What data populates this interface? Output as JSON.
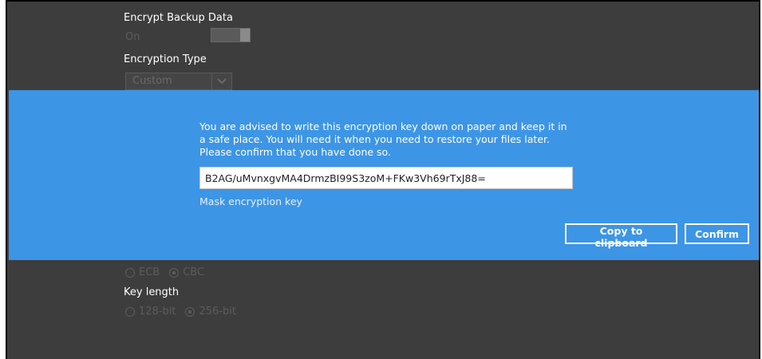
{
  "background": {
    "encrypt_label": "Encrypt Backup Data",
    "encrypt_value": "On",
    "type_label": "Encryption Type",
    "type_value": "Custom",
    "mode_options": [
      "ECB",
      "CBC"
    ],
    "mode_selected": "CBC",
    "key_length_label": "Key length",
    "key_length_options": [
      "128-bit",
      "256-bit"
    ],
    "key_length_selected": "256-bit"
  },
  "dialog": {
    "message_line1": "You are advised to write this encryption key down on paper and keep it in",
    "message_line2": "a safe place. You will need it when you need to restore your files later.",
    "message_line3": "Please confirm that you have done so.",
    "key_value": "B2AG/uMvnxgvMA4DrmzBI99S3zoM+FKw3Vh69rTxJ88=",
    "mask_label": "Mask encryption key",
    "copy_label": "Copy to clipboard",
    "confirm_label": "Confirm"
  },
  "colors": {
    "dialog_bg": "#3d95e6",
    "overlay_bg": "#3d3d3d"
  }
}
